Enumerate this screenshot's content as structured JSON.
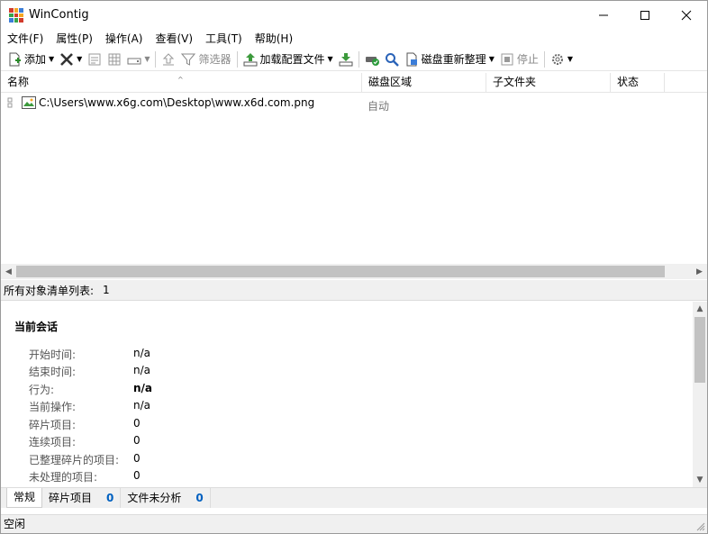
{
  "window": {
    "title": "WinContig"
  },
  "menu": [
    {
      "id": "file",
      "label": "文件(F)"
    },
    {
      "id": "properties",
      "label": "属性(P)"
    },
    {
      "id": "action",
      "label": "操作(A)"
    },
    {
      "id": "view",
      "label": "查看(V)"
    },
    {
      "id": "tools",
      "label": "工具(T)"
    },
    {
      "id": "help",
      "label": "帮助(H)"
    }
  ],
  "toolbar": {
    "add_label": "添加",
    "filter_label": "筛选器",
    "load_profile_label": "加载配置文件",
    "defrag_label": "磁盘重新整理",
    "stop_label": "停止"
  },
  "list": {
    "columns": [
      "名称",
      "磁盘区域",
      "子文件夹",
      "状态"
    ],
    "rows": [
      {
        "name": "C:\\Users\\www.x6g.com\\Desktop\\www.x6d.com.png",
        "zone": "自动",
        "subfolder": "",
        "status": ""
      }
    ]
  },
  "list_status": {
    "label": "所有对象清单列表:",
    "count": "1"
  },
  "session": {
    "title": "当前会话",
    "fields": [
      {
        "key": "开始时间:",
        "value": "n/a",
        "bold": false
      },
      {
        "key": "结束时间:",
        "value": "n/a",
        "bold": false
      },
      {
        "key": "行为:",
        "value": "n/a",
        "bold": true
      },
      {
        "key": "当前操作:",
        "value": "n/a",
        "bold": false
      },
      {
        "key": "碎片项目:",
        "value": "0",
        "bold": false
      },
      {
        "key": "连续项目:",
        "value": "0",
        "bold": false
      },
      {
        "key": "已整理碎片的项目:",
        "value": "0",
        "bold": false
      },
      {
        "key": "未处理的项目:",
        "value": "0",
        "bold": false
      }
    ]
  },
  "tabs": [
    {
      "label": "常规",
      "count": ""
    },
    {
      "label": "碎片项目",
      "count": "0"
    },
    {
      "label": "文件未分析",
      "count": "0"
    }
  ],
  "statusbar": {
    "text": "空闲"
  },
  "colors": {
    "accent": "#0060c0",
    "scrollbar_thumb": "#c2c2c2",
    "panel_bg": "#f0f0f0"
  }
}
